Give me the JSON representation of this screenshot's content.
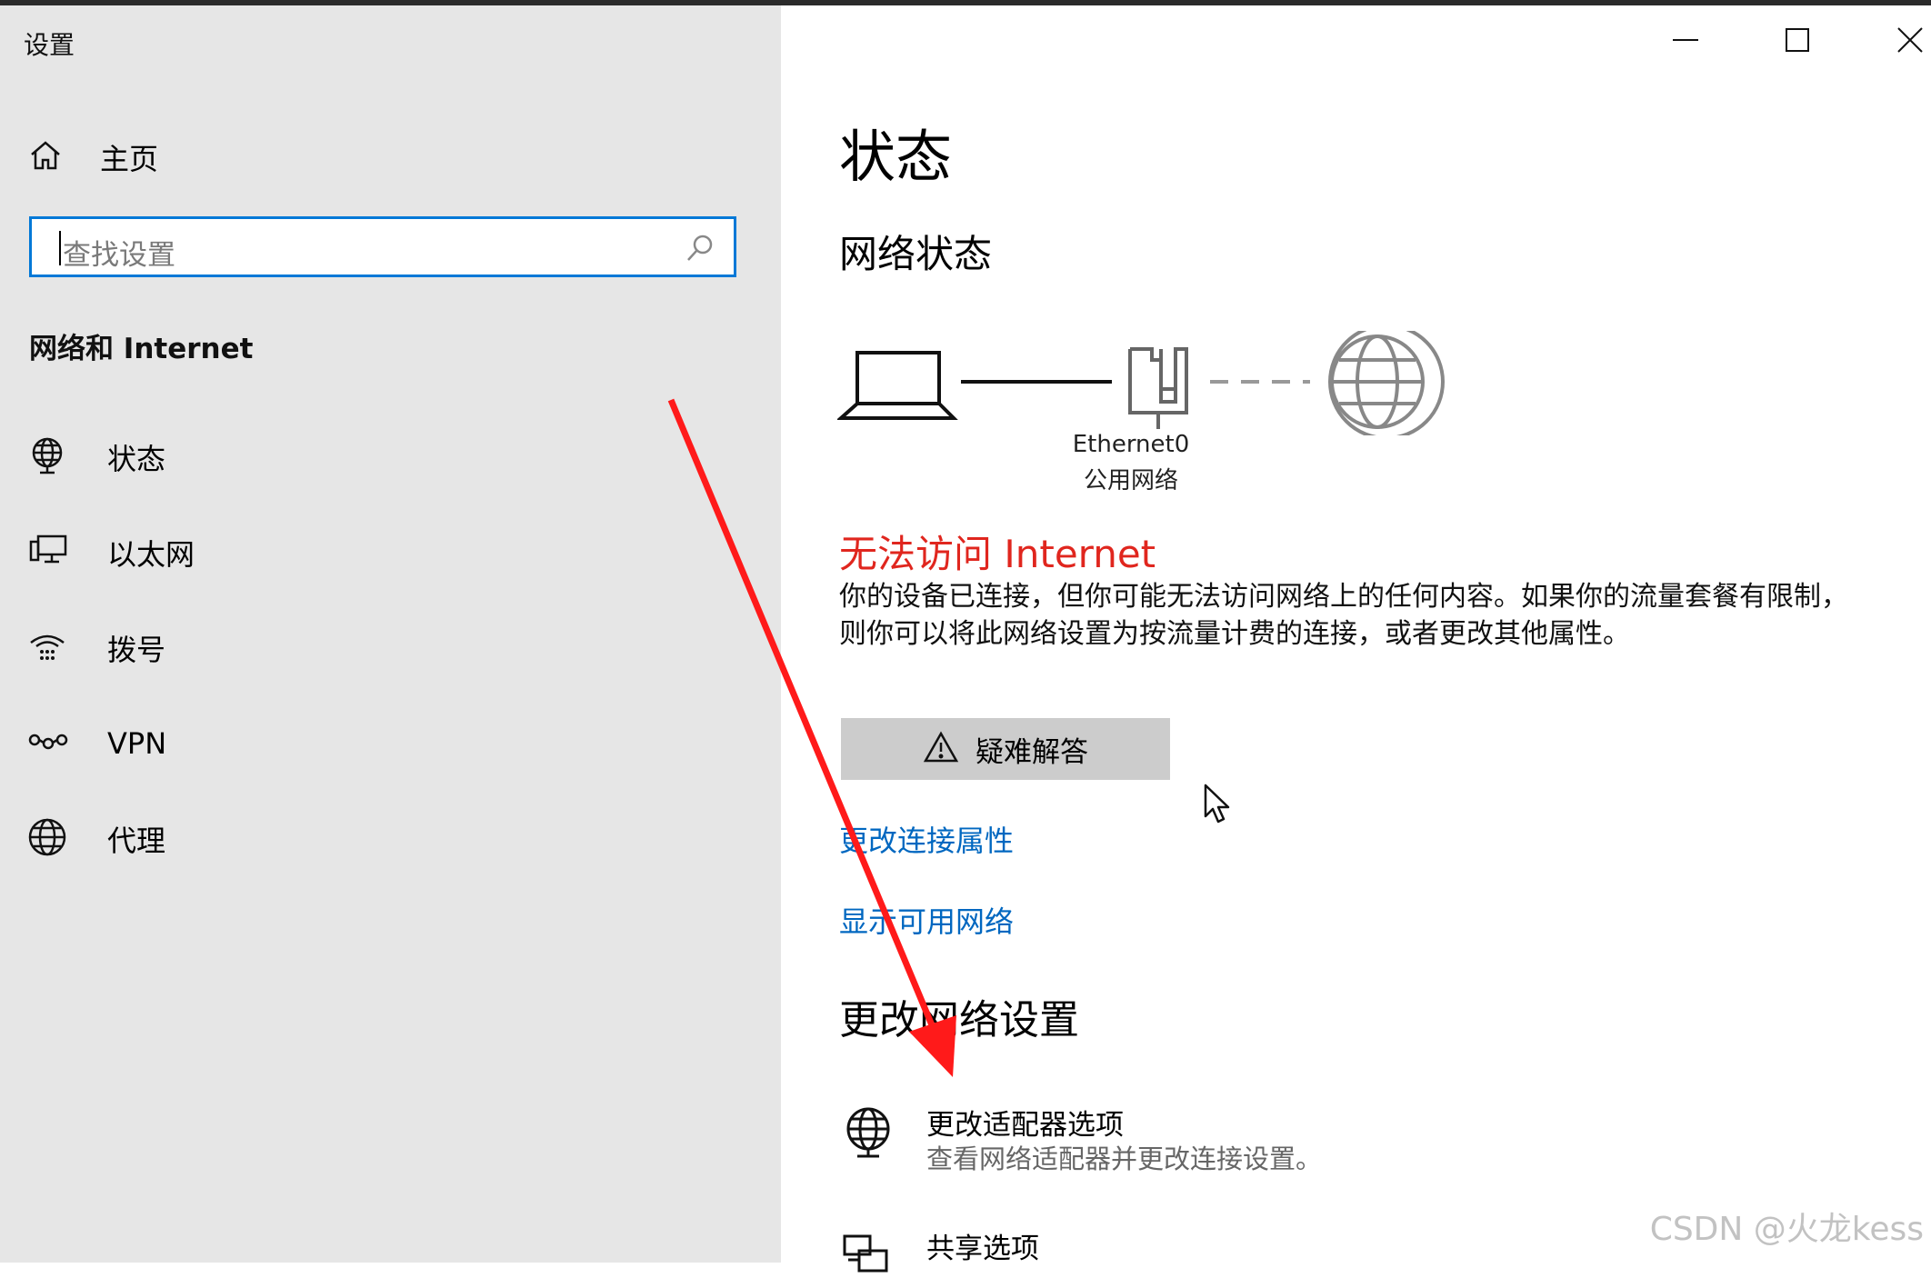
{
  "window": {
    "title": "设置",
    "controls": {
      "minimize": "minimize-icon",
      "maximize": "maximize-icon",
      "close": "close-icon"
    }
  },
  "sidebar": {
    "home_label": "主页",
    "search_placeholder": "查找设置",
    "section_title": "网络和 Internet",
    "items": [
      {
        "label": "状态",
        "icon": "status-globe-icon"
      },
      {
        "label": "以太网",
        "icon": "ethernet-icon"
      },
      {
        "label": "拨号",
        "icon": "dialup-icon"
      },
      {
        "label": "VPN",
        "icon": "vpn-icon"
      },
      {
        "label": "代理",
        "icon": "globe-icon"
      }
    ]
  },
  "main": {
    "title": "状态",
    "network_status_heading": "网络状态",
    "connection": {
      "name": "Ethernet0",
      "type": "公用网络"
    },
    "error_title": "无法访问 Internet",
    "error_description": "你的设备已连接，但你可能无法访问网络上的任何内容。如果你的流量套餐有限制，则你可以将此网络设置为按流量计费的连接，或者更改其他属性。",
    "troubleshoot_label": "疑难解答",
    "links": {
      "change_connection_properties": "更改连接属性",
      "show_available_networks": "显示可用网络"
    },
    "change_settings_heading": "更改网络设置",
    "options": [
      {
        "title": "更改适配器选项",
        "subtitle": "查看网络适配器并更改连接设置。",
        "icon": "adapter-globe-icon"
      },
      {
        "title": "共享选项",
        "subtitle": "",
        "icon": "sharing-icon"
      }
    ]
  },
  "watermark": "CSDN @火龙kess",
  "colors": {
    "accent": "#0078d7",
    "link": "#0067c0",
    "error": "#e0261e",
    "annotation_arrow": "#ff1a1a"
  }
}
